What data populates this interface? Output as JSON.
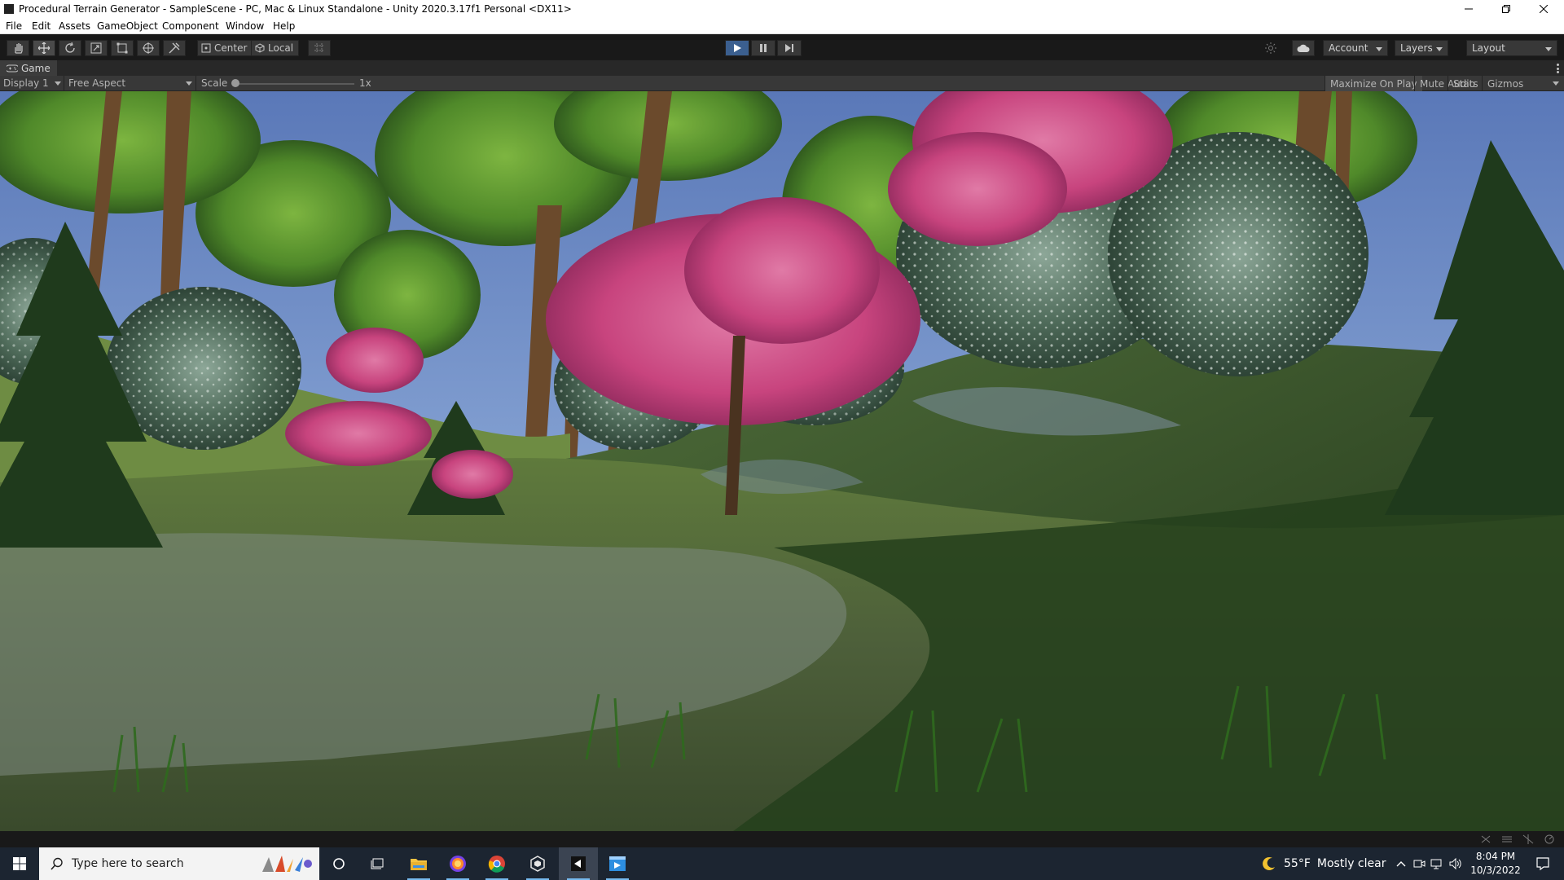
{
  "window": {
    "title": "Procedural Terrain Generator - SampleScene - PC, Mac & Linux Standalone - Unity 2020.3.17f1 Personal <DX11>",
    "controls": [
      "minimize-icon",
      "restore-icon",
      "close-icon"
    ]
  },
  "menu": {
    "items": [
      "File",
      "Edit",
      "Assets",
      "GameObject",
      "Component",
      "Window",
      "Help"
    ]
  },
  "toolbar": {
    "tools": [
      "hand-icon",
      "move-icon",
      "rotate-icon",
      "scale-icon",
      "rect-icon",
      "transform-icon",
      "custom-tool-icon"
    ],
    "pivot_mode": "Center",
    "pivot_rotation": "Local",
    "account_label": "Account",
    "layers_label": "Layers",
    "layout_label": "Layout",
    "play_state": "playing"
  },
  "game_tab": {
    "label": "Game"
  },
  "game_view": {
    "display": "Display 1",
    "aspect": "Free Aspect",
    "scale_label": "Scale",
    "scale_value": "1x",
    "maximize_on_play": "Maximize On Play",
    "mute_audio": "Mute Audio",
    "stats": "Stats",
    "gizmos": "Gizmos"
  },
  "taskbar": {
    "search_placeholder": "Type here to search",
    "weather_temp": "55°F",
    "weather_text": "Mostly clear",
    "time": "8:04 PM",
    "date": "10/3/2022",
    "pinned": [
      "cortana-icon",
      "task-view-icon",
      "file-explorer-icon",
      "firefox-icon",
      "chrome-icon",
      "unity-hub-icon",
      "unity-editor-icon",
      "visual-studio-icon"
    ]
  },
  "colors": {
    "editor_bg": "#191919",
    "panel_bg": "#383838",
    "play_active": "#3b5f8f",
    "taskbar_bg": "#1c2531",
    "sky_top": "#5a78b8",
    "sky_bottom": "#a9c3e6",
    "blossom": "#c8447e",
    "foliage": "#4f8a22"
  }
}
